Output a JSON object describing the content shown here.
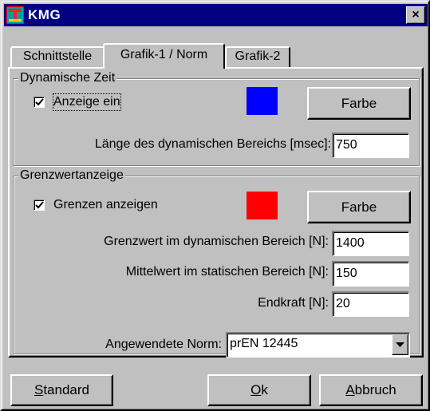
{
  "window": {
    "title": "KMG",
    "close_glyph": "×",
    "icon": "app-logo-icon"
  },
  "tabs": [
    {
      "label": "Schnittstelle",
      "active": false
    },
    {
      "label": "Grafik-1 / Norm",
      "active": true
    },
    {
      "label": "Grafik-2",
      "active": false
    }
  ],
  "dynamic_group": {
    "title": "Dynamische Zeit",
    "checkbox_label": "Anzeige ein",
    "checked": true,
    "color": "#0000ff",
    "color_button": "Farbe",
    "length_label": "Länge des dynamischen Bereichs [msec]:",
    "length_value": "750"
  },
  "limit_group": {
    "title": "Grenzwertanzeige",
    "checkbox_label": "Grenzen anzeigen",
    "checked": true,
    "color": "#ff0000",
    "color_button": "Farbe",
    "fields": [
      {
        "label": "Grenzwert im dynamischen Bereich [N]:",
        "value": "1400"
      },
      {
        "label": "Mittelwert im statischen Bereich [N]:",
        "value": "150"
      },
      {
        "label": "Endkraft [N]:",
        "value": "20"
      }
    ],
    "norm_label": "Angewendete Norm:",
    "norm_value": "prEN 12445"
  },
  "buttons": {
    "standard_first": "S",
    "standard_rest": "tandard",
    "ok_first": "O",
    "ok_rest": "k",
    "cancel_first": "A",
    "cancel_rest": "bbruch"
  }
}
